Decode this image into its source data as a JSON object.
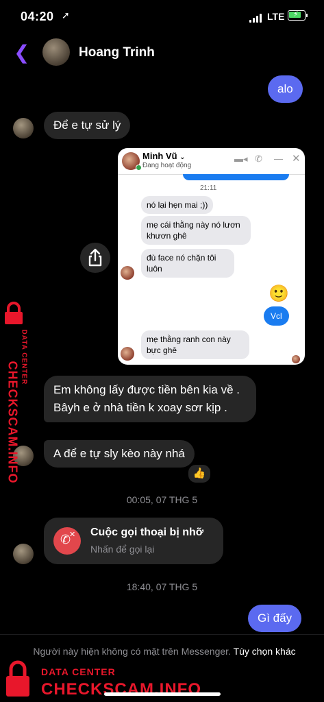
{
  "status": {
    "time": "04:20",
    "location_icon": "location-arrow-icon",
    "network": "LTE",
    "battery_color": "#4cd964"
  },
  "header": {
    "back_icon": "chevron-left-icon",
    "contact_name": "Hoang Trinh"
  },
  "messages": {
    "out_1": "alo",
    "in_1": "Để e tự sử lý",
    "in_2": "Em không lấy được tiền bên kia về . Bâyh e ở nhà tiền k xoay sơr kịp .",
    "in_3": "A để e tự sly kèo này nhá",
    "reaction": "👍",
    "out_2": "Gì đấy"
  },
  "screenshot": {
    "name": "Minh Vũ",
    "status": "Đang hoạt động",
    "time": "21:11",
    "msg_1": "nó lại hẹn mai ;))",
    "msg_2": "mẹ cái thằng này nó lươn khươn ghê",
    "msg_3": "đù face nó chặn tôi luôn",
    "emoji": "🙂",
    "msg_out": "Vcl",
    "msg_4": "mẹ thằng ranh con này bực ghê"
  },
  "timestamps": {
    "ts_1": "00:05, 07 THG 5",
    "ts_2": "18:40, 07 THG 5"
  },
  "missed_call": {
    "title": "Cuộc gọi thoại bị nhỡ",
    "subtitle": "Nhấn để gọi lại"
  },
  "footer": {
    "notice": "Người này hiện không có mặt trên Messenger.",
    "action": "Tùy chọn khác"
  },
  "watermark": {
    "line1": "DATA CENTER",
    "line2": "CHECKSCAM.INFO",
    "color": "#e8172b"
  },
  "colors": {
    "accent": "#8a4dff",
    "outgoing": "#5b6af0",
    "incoming": "#262626",
    "missed_call": "#e2474c"
  }
}
